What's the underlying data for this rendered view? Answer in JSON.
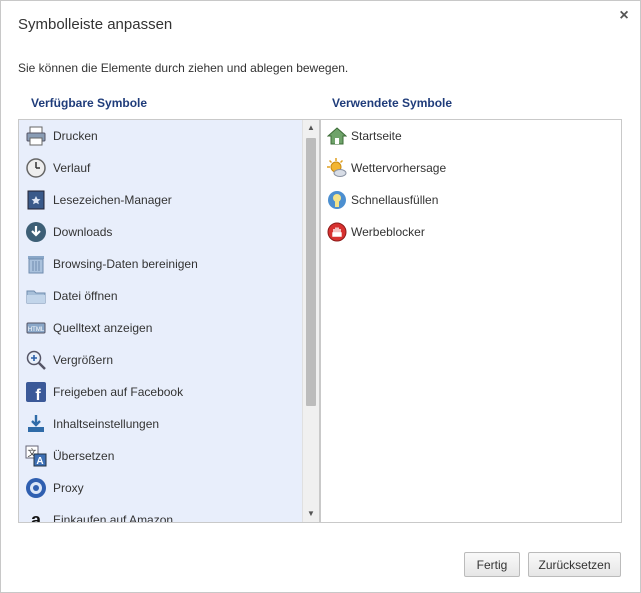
{
  "dialog": {
    "title": "Symbolleiste anpassen",
    "close_label": "×",
    "description": "Sie können die Elemente durch ziehen und ablegen bewegen."
  },
  "available": {
    "heading": "Verfügbare Symbole",
    "items": [
      {
        "label": "Drucken",
        "icon": "printer-icon"
      },
      {
        "label": "Verlauf",
        "icon": "clock-icon"
      },
      {
        "label": "Lesezeichen-Manager",
        "icon": "bookmark-book-icon"
      },
      {
        "label": "Downloads",
        "icon": "download-circle-icon"
      },
      {
        "label": "Browsing-Daten bereinigen",
        "icon": "trash-icon"
      },
      {
        "label": "Datei öffnen",
        "icon": "folder-icon"
      },
      {
        "label": "Quelltext anzeigen",
        "icon": "html-source-icon"
      },
      {
        "label": "Vergrößern",
        "icon": "zoom-in-icon"
      },
      {
        "label": "Freigeben auf Facebook",
        "icon": "facebook-icon"
      },
      {
        "label": "Inhaltseinstellungen",
        "icon": "content-settings-icon"
      },
      {
        "label": "Übersetzen",
        "icon": "translate-icon"
      },
      {
        "label": "Proxy",
        "icon": "proxy-icon"
      },
      {
        "label": "Einkaufen auf Amazon",
        "icon": "amazon-icon"
      }
    ]
  },
  "used": {
    "heading": "Verwendete Symbole",
    "items": [
      {
        "label": "Startseite",
        "icon": "home-icon"
      },
      {
        "label": "Wettervorhersage",
        "icon": "weather-icon"
      },
      {
        "label": "Schnellausfüllen",
        "icon": "autofill-icon"
      },
      {
        "label": "Werbeblocker",
        "icon": "adblock-icon"
      }
    ]
  },
  "buttons": {
    "ok_label": "Fertig",
    "reset_label": "Zurücksetzen"
  },
  "colors": {
    "heading": "#1f3c7a",
    "left_panel_bg": "#e8eefb"
  }
}
